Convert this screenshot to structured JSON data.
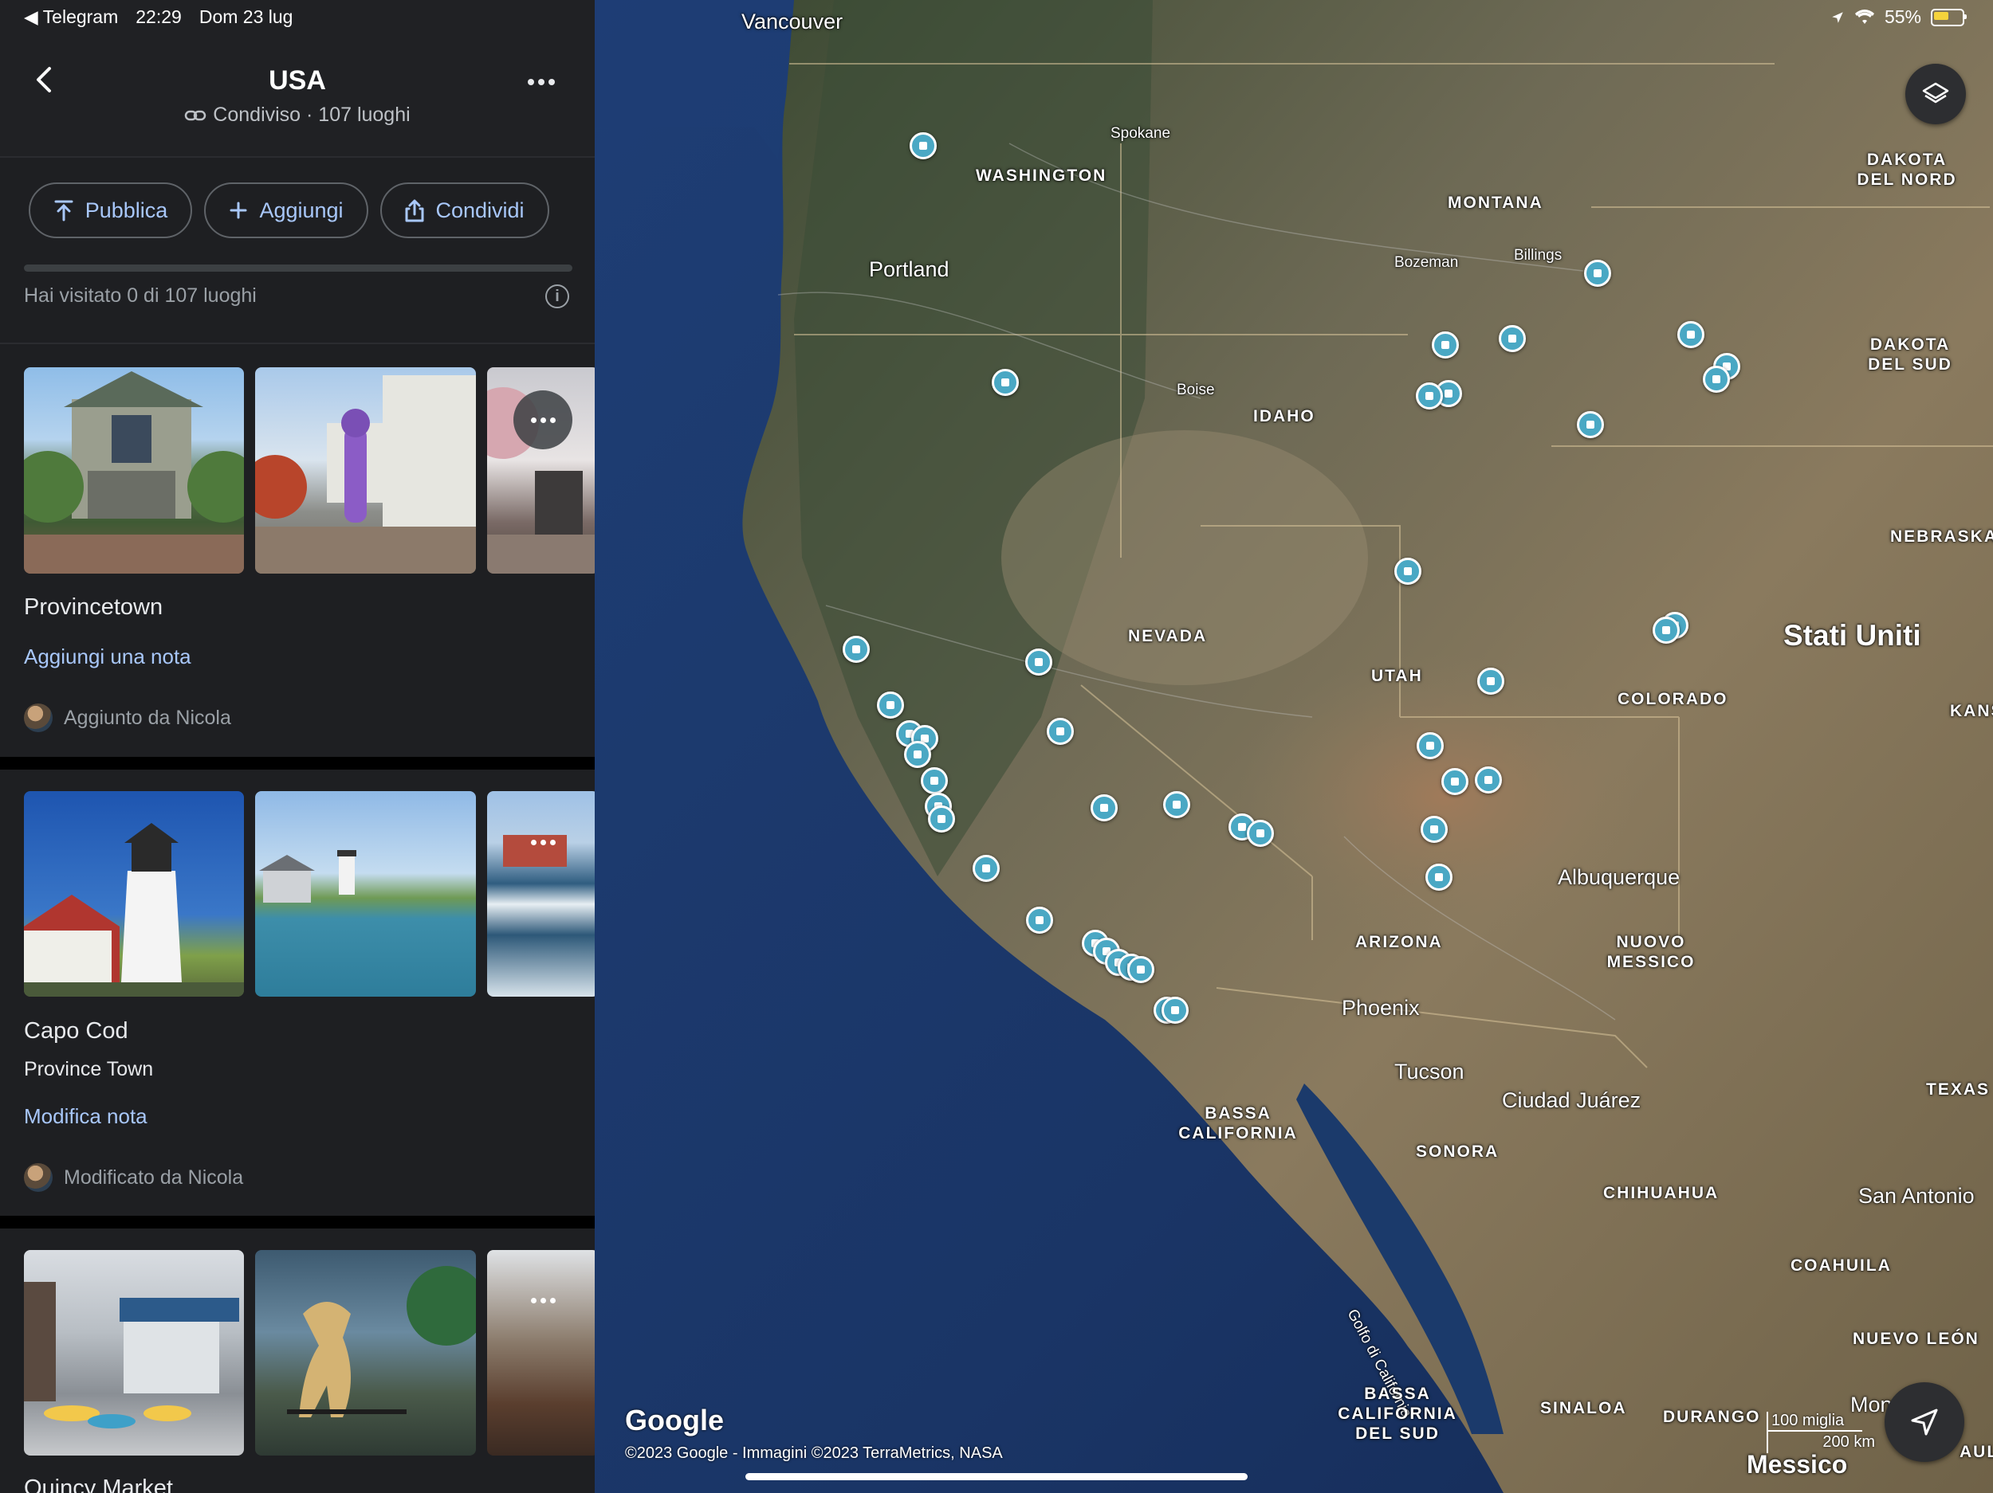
{
  "status_bar": {
    "back_app": "◀ Telegram",
    "time": "22:29",
    "date": "Dom 23 lug",
    "battery": "55%"
  },
  "header": {
    "title": "USA",
    "subtitle": "Condiviso · 107 luoghi"
  },
  "actions": {
    "publish": "Pubblica",
    "add": "Aggiungi",
    "share": "Condividi"
  },
  "progress": {
    "text": "Hai visitato 0 di 107 luoghi",
    "visited": 0,
    "total": 107
  },
  "places": [
    {
      "title": "Provincetown",
      "subtitle": "",
      "note_link": "Aggiungi una nota",
      "by": "Aggiunto da Nicola"
    },
    {
      "title": "Capo Cod",
      "subtitle": "Province Town",
      "note_link": "Modifica nota",
      "by": "Modificato da Nicola"
    },
    {
      "title": "Quincy Market",
      "subtitle": "",
      "note_link": "",
      "by": ""
    }
  ],
  "map": {
    "labels": {
      "vancouver": "Vancouver",
      "spokane": "Spokane",
      "washington": "WASHINGTON",
      "montana": "MONTANA",
      "dakota_nord": "DAKOTA DEL NORD",
      "portland": "Portland",
      "bozeman": "Bozeman",
      "billings": "Billings",
      "boise": "Boise",
      "idaho": "IDAHO",
      "dakota_sud": "DAKOTA DEL SUD",
      "nebraska": "NEBRASKA",
      "nevada": "NEVADA",
      "utah": "UTAH",
      "stati_uniti": "Stati Uniti",
      "colorado": "COLORADO",
      "kans": "KANS",
      "albuquerque": "Albuquerque",
      "arizona": "ARIZONA",
      "nuovo_messico": "NUOVO MESSICO",
      "phoenix": "Phoenix",
      "tucson": "Tucson",
      "ciudad_juarez": "Ciudad Juárez",
      "texas": "TEXAS",
      "bassa_california": "BASSA CALIFORNIA",
      "sonora": "SONORA",
      "chihuahua": "CHIHUAHUA",
      "san_antonio": "San Antonio",
      "coahuila": "COAHUILA",
      "golfo": "Golfo di California",
      "nuevo_leon": "NUEVO LEÓN",
      "bassa_california_sud": "BASSA CALIFORNIA DEL SUD",
      "sinaloa": "SINALOA",
      "durango": "DURANGO",
      "messico": "Messico",
      "mon": "Mon",
      "aulip": "AULIP"
    },
    "google": "Google",
    "attribution": "©2023 Google - Immagini ©2023 TerraMetrics, NASA",
    "scale_miles": "100 miglia",
    "scale_km": "200 km"
  },
  "icons": {
    "back": "chevron-left-icon",
    "more": "more-horiz-icon",
    "link": "link-icon",
    "publish": "upload-icon",
    "add": "plus-icon",
    "share": "share-icon",
    "info": "info-icon",
    "layers": "layers-icon",
    "location": "navigation-icon"
  }
}
